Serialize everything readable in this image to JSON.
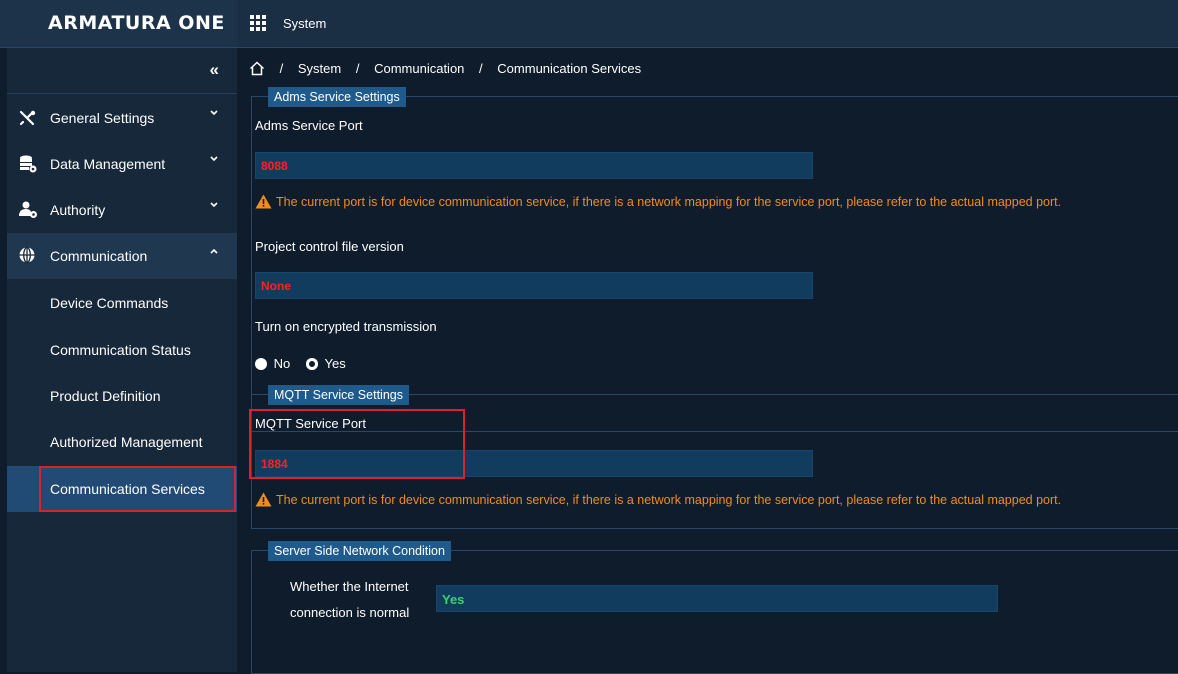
{
  "header": {
    "logo": "ARMATURA ONE",
    "app_title": "System",
    "apps_icon": "grid-icon"
  },
  "sidebar": {
    "collapse_label": "«",
    "items": [
      {
        "label": "General Settings",
        "icon": "tools-icon",
        "chevron": "⌄"
      },
      {
        "label": "Data Management",
        "icon": "database-icon",
        "chevron": "⌄"
      },
      {
        "label": "Authority",
        "icon": "users-icon",
        "chevron": "⌄"
      },
      {
        "label": "Communication",
        "icon": "globe-icon",
        "chevron": "⌃"
      }
    ],
    "sub_items": [
      {
        "label": "Device Commands"
      },
      {
        "label": "Communication Status"
      },
      {
        "label": "Product Definition"
      },
      {
        "label": "Authorized Management"
      },
      {
        "label": "Communication Services"
      }
    ]
  },
  "breadcrumb": {
    "sep": "/",
    "items": [
      "System",
      "Communication",
      "Communication Services"
    ]
  },
  "adms": {
    "legend": "Adms Service Settings",
    "port_label": "Adms Service Port",
    "port_value": "8088",
    "warning": "The current port is for device communication service, if there is a network mapping for the service port, please refer to the actual mapped port.",
    "version_label": "Project control file version",
    "version_value": "None",
    "encrypt_label": "Turn on encrypted transmission",
    "opt_no": "No",
    "opt_yes": "Yes",
    "selected": "Yes"
  },
  "mqtt": {
    "legend": "MQTT Service Settings",
    "port_label": "MQTT Service Port",
    "port_value": "1884",
    "warning": "The current port is for device communication service, if there is a network mapping for the service port, please refer to the actual mapped port."
  },
  "server": {
    "legend": "Server Side Network Condition",
    "internet_label_line1": "Whether the Internet",
    "internet_label_line2": "connection is normal",
    "internet_value": "Yes"
  },
  "colors": {
    "accent": "#1e5a8c",
    "warning": "#f28c1c",
    "error_value": "#ff2020",
    "ok_value": "#39d36a",
    "highlight_box": "#d9232b"
  }
}
